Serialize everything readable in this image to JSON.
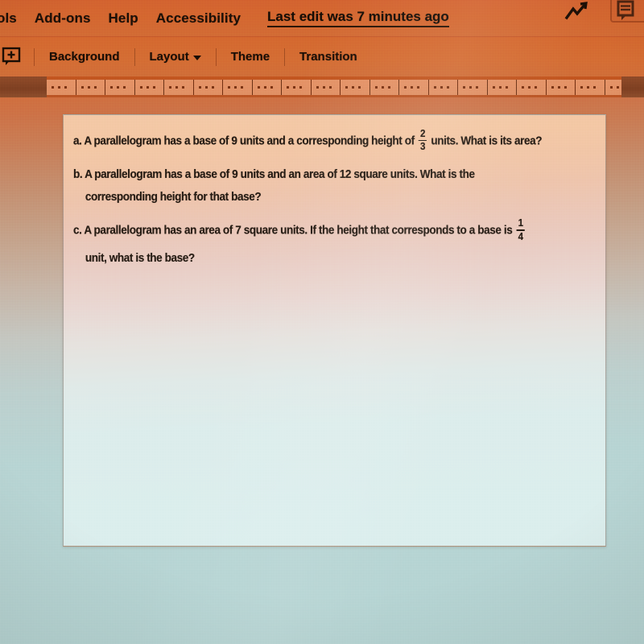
{
  "app": {
    "name": "Google Slides",
    "menubar": {
      "items": [
        {
          "label": "ols",
          "truncated": true
        },
        {
          "label": "Add-ons"
        },
        {
          "label": "Help"
        },
        {
          "label": "Accessibility"
        }
      ],
      "last_edit": "Last edit was 7 minutes ago",
      "right_icons": [
        {
          "name": "explore-icon",
          "glyph": "zigzag-arrow"
        },
        {
          "name": "comment-icon",
          "glyph": "comment-box"
        }
      ],
      "present_button_label": ""
    },
    "toolbar": {
      "new_slide_icon": "new-slide-icon",
      "items": [
        {
          "label": "Background",
          "has_caret": false
        },
        {
          "label": "Layout",
          "has_caret": true
        },
        {
          "label": "Theme",
          "has_caret": false
        },
        {
          "label": "Transition",
          "has_caret": false
        }
      ]
    },
    "ruler": {
      "name": "horizontal-ruler",
      "segments": 20
    }
  },
  "slide": {
    "questions": [
      {
        "id": "a",
        "lines": [
          [
            {
              "t": "text",
              "v": "a. A parallelogram has a base of 9 units and a corresponding height of "
            },
            {
              "t": "frac",
              "num": "2",
              "den": "3"
            },
            {
              "t": "text",
              "v": " units. What is its area?"
            }
          ]
        ]
      },
      {
        "id": "b",
        "lines": [
          [
            {
              "t": "text",
              "v": "b. A parallelogram has a base of 9 units and an area of 12 square units. What is the"
            }
          ],
          [
            {
              "t": "text",
              "v": "corresponding height for that base?"
            }
          ]
        ]
      },
      {
        "id": "c",
        "lines": [
          [
            {
              "t": "text",
              "v": "c. A parallelogram has an area of 7 square units. If the height that corresponds to a base is "
            },
            {
              "t": "frac",
              "num": "1",
              "den": "4"
            }
          ],
          [
            {
              "t": "text",
              "v": "unit, what is the base?"
            }
          ]
        ]
      }
    ]
  },
  "colors": {
    "menubar_orange": "#d4662f",
    "toolbar_orange": "#d46c33",
    "ruler_band": "#b64e1d",
    "ruler_face": "#e0905f",
    "slide_warm": "#f3c8a5",
    "slide_cool": "#dbeeed",
    "workspace_cool": "#b5d4d3",
    "text_dark": "#241a12"
  }
}
